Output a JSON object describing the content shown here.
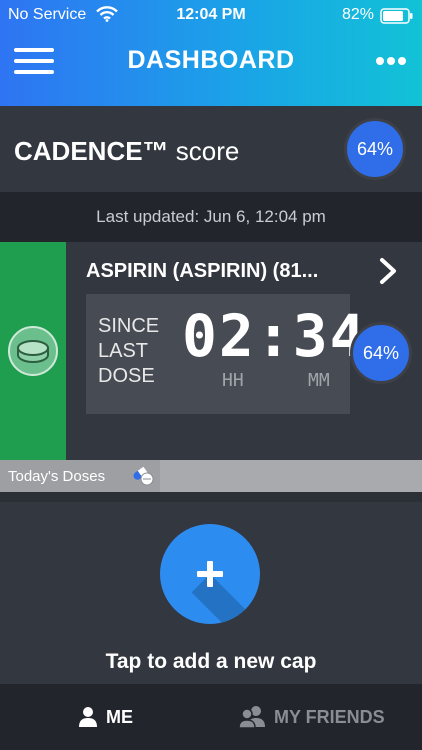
{
  "status_bar": {
    "carrier": "No Service",
    "time": "12:04 PM",
    "battery": "82%"
  },
  "header": {
    "title": "DASHBOARD",
    "menu_icon": "menu-icon",
    "more_icon": "more-icon"
  },
  "score": {
    "title_bold": "CADENCE™",
    "title_rest": " score",
    "value": "64%"
  },
  "last_updated": "Last updated: Jun 6, 12:04 pm",
  "medication": {
    "name": "ASPIRIN (ASPIRIN) (81...",
    "since_lines": [
      "SINCE",
      "LAST",
      "DOSE"
    ],
    "timer": "02:34",
    "unit_hours": "HH",
    "unit_minutes": "MM",
    "adherence": "64%",
    "accent_color": "#1f9e4f"
  },
  "doses": {
    "label": "Today's Doses",
    "icon": "pills-icon"
  },
  "add_cap": {
    "label": "Tap to add a new cap",
    "icon": "plus-icon"
  },
  "tabs": [
    {
      "label": "ME",
      "icon": "person-icon",
      "active": true
    },
    {
      "label": "MY FRIENDS",
      "icon": "friends-icon",
      "active": false
    }
  ],
  "colors": {
    "header_gradient_start": "#2f74f3",
    "header_gradient_end": "#12c2d6",
    "badge": "#2f6ee8",
    "add_button": "#2d8cf0"
  }
}
